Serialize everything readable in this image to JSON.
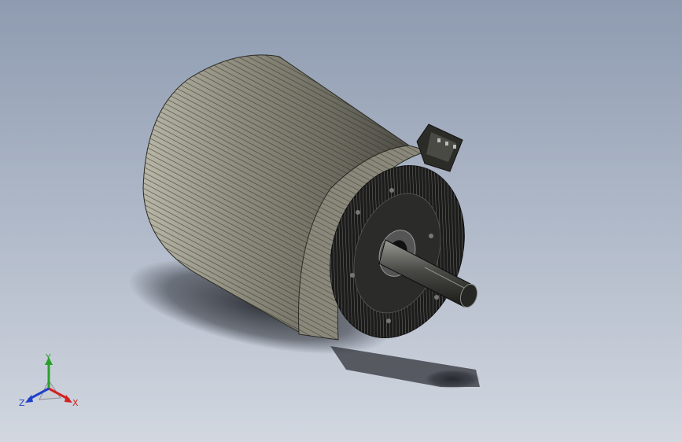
{
  "viewport": {
    "background_top": "#8e9bb0",
    "background_bottom": "#d2d7e0"
  },
  "model": {
    "body_color": "#9a9888",
    "dark_color": "#1c1c1c",
    "line_color": "#2a2a24"
  },
  "triad": {
    "x_label": "X",
    "y_label": "Y",
    "z_label": "Z",
    "x_color": "#d42020",
    "y_color": "#2aa02a",
    "z_color": "#2040c8"
  }
}
